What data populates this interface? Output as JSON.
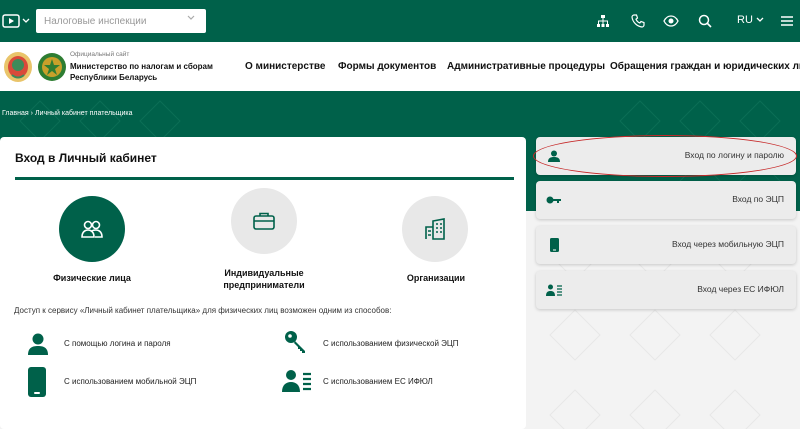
{
  "topbar": {
    "select_value": "Налоговые инспекции",
    "language": "RU",
    "icons": [
      "visually-impaired-icon",
      "sitemap-icon",
      "phone-icon",
      "eye-icon",
      "search-icon",
      "menu-icon"
    ]
  },
  "header": {
    "site_subtitle": "Официальный сайт",
    "site_name": "Министерство по налогам и сборам Республики Беларусь",
    "nav": [
      "О министерстве",
      "Формы документов",
      "Административные процедуры",
      "Обращения граждан и юридических лиц"
    ]
  },
  "breadcrumb": {
    "home": "Главная",
    "separator": "›",
    "current": "Личный кабинет плательщика"
  },
  "card": {
    "title": "Вход в Личный кабинет",
    "types": [
      {
        "label": "Физические лица",
        "active": true
      },
      {
        "label": "Индивидуальные предприниматели",
        "active": false
      },
      {
        "label": "Организации",
        "active": false
      }
    ],
    "intro": "Доступ к сервису «Личный кабинет плательщика» для физических лиц возможен одним из способов:",
    "methods": [
      {
        "label": "С помощью логина и пароля",
        "icon": "user-icon"
      },
      {
        "label": "С использованием физической ЭЦП",
        "icon": "key-icon"
      },
      {
        "label": "С использованием мобильной ЭЦП",
        "icon": "mobile-icon"
      },
      {
        "label": "С использованием ЕС ИФЮЛ",
        "icon": "id-card-icon"
      }
    ]
  },
  "login_options": [
    {
      "label": "Вход по логину и паролю",
      "icon": "user-icon",
      "highlighted": true
    },
    {
      "label": "Вход по ЭЦП",
      "icon": "key-icon",
      "highlighted": false
    },
    {
      "label": "Вход через мобильную ЭЦП",
      "icon": "mobile-icon",
      "highlighted": false
    },
    {
      "label": "Вход через ЕС ИФЮЛ",
      "icon": "id-card-icon",
      "highlighted": false
    }
  ],
  "colors": {
    "brand_green": "#00614a",
    "highlight_red": "#c62828",
    "inactive_circle": "#e8e8e8"
  }
}
